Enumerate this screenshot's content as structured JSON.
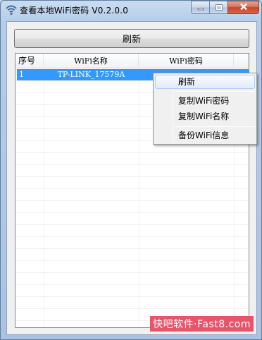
{
  "window": {
    "title": "查看本地WiFi密码 V0.2.0.0"
  },
  "toolbar": {
    "refresh_label": "刷新"
  },
  "list": {
    "columns": [
      "序号",
      "WiFi名称",
      "WiFi密码"
    ],
    "rows": [
      {
        "index": "1",
        "name": "TP-LINK_17579A",
        "password": ""
      }
    ],
    "selected_row": 0
  },
  "context_menu": {
    "items": [
      {
        "label": "刷新",
        "highlighted": true
      },
      {
        "label": "复制WiFi密码"
      },
      {
        "label": "复制WiFi名称"
      },
      {
        "label": "备份WiFi信息"
      }
    ]
  },
  "watermark": {
    "text": "快吧软件·Fast8.com"
  },
  "colors": {
    "selection": "#3399ff",
    "close_button": "#c6452a",
    "watermark_bg": "#e8556a"
  },
  "icons": {
    "app": "wifi-icon",
    "minimize": "minimize-icon",
    "maximize": "maximize-icon",
    "close": "close-icon"
  }
}
